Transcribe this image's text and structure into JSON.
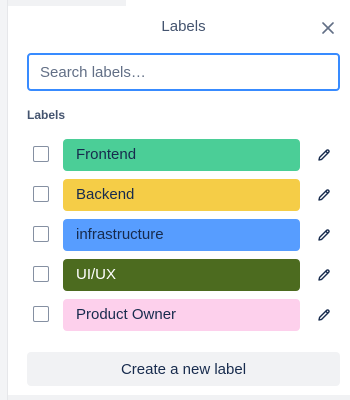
{
  "header": {
    "title": "Labels",
    "close_icon": "close-icon"
  },
  "search": {
    "placeholder": "Search labels…",
    "value": ""
  },
  "labels_section": {
    "heading": "Labels",
    "items": [
      {
        "name": "Frontend",
        "color": "#4bce97",
        "text_color": "#172b4d",
        "checked": false
      },
      {
        "name": "Backend",
        "color": "#f5cd47",
        "text_color": "#172b4d",
        "checked": false
      },
      {
        "name": "infrastructure",
        "color": "#579dff",
        "text_color": "#172b4d",
        "checked": false
      },
      {
        "name": "UI/UX",
        "color": "#4c6b1f",
        "text_color": "#ffffff",
        "checked": false
      },
      {
        "name": "Product Owner",
        "color": "#fdd0ec",
        "text_color": "#172b4d",
        "checked": false
      }
    ],
    "edit_icon": "pencil-icon"
  },
  "footer": {
    "create_label": "Create a new label"
  },
  "colors": {
    "focus_border": "#388bff",
    "button_bg": "#f1f2f4",
    "text": "#172b4d",
    "subtle_text": "#44546f"
  }
}
